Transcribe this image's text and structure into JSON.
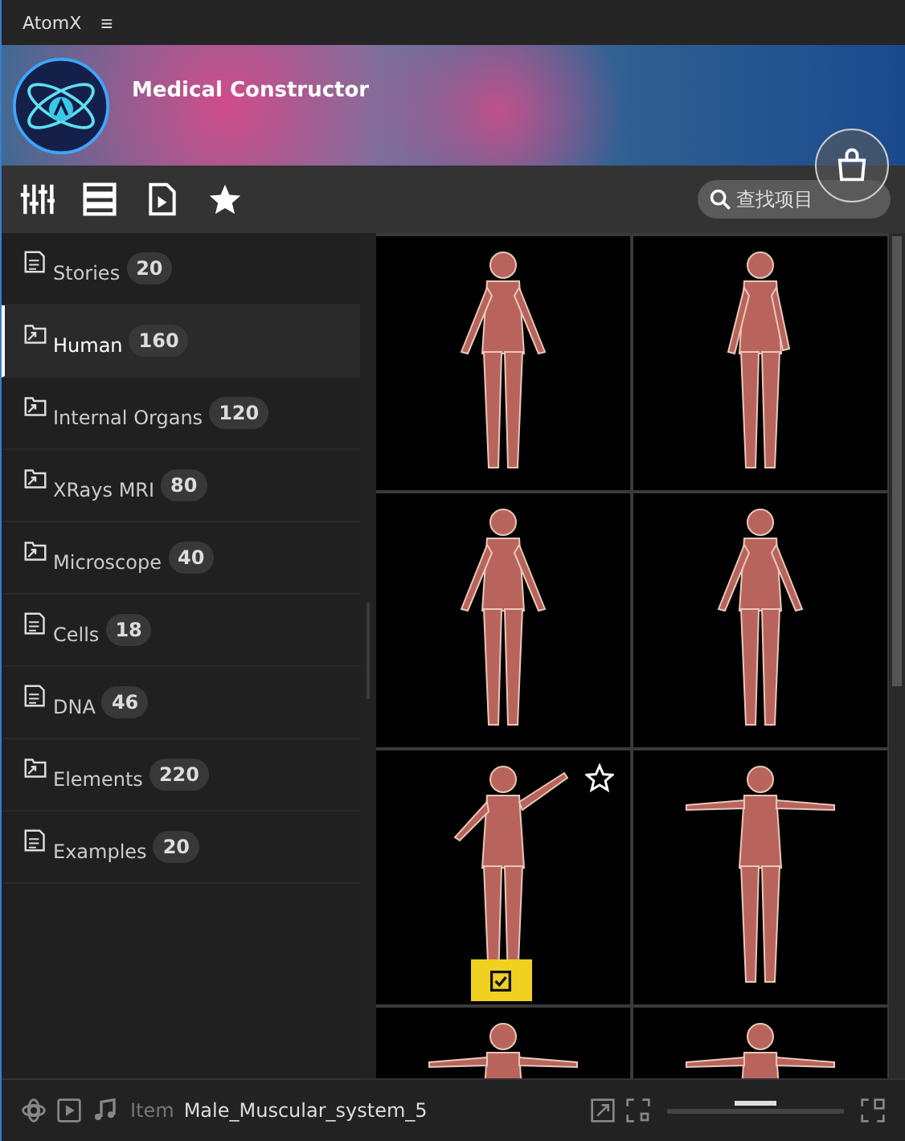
{
  "window": {
    "title": "AtomX",
    "menu_glyph": "≡"
  },
  "banner": {
    "title": "Medical Constructor"
  },
  "search": {
    "placeholder": "查找项目"
  },
  "categories": [
    {
      "kind": "ae",
      "label": "Stories",
      "count": "20",
      "selected": false
    },
    {
      "kind": "folder",
      "label": "Human",
      "count": "160",
      "selected": true
    },
    {
      "kind": "folder",
      "label": "Internal Organs",
      "count": "120",
      "selected": false
    },
    {
      "kind": "folder",
      "label": "XRays MRI",
      "count": "80",
      "selected": false
    },
    {
      "kind": "folder",
      "label": "Microscope",
      "count": "40",
      "selected": false
    },
    {
      "kind": "ae",
      "label": "Cells",
      "count": "18",
      "selected": false
    },
    {
      "kind": "ae",
      "label": "DNA",
      "count": "46",
      "selected": false
    },
    {
      "kind": "folder",
      "label": "Elements",
      "count": "220",
      "selected": false
    },
    {
      "kind": "ae",
      "label": "Examples",
      "count": "20",
      "selected": false
    }
  ],
  "tiles": [
    {
      "kind": "front",
      "hovered": false
    },
    {
      "kind": "turned",
      "hovered": false
    },
    {
      "kind": "front",
      "hovered": false
    },
    {
      "kind": "front",
      "hovered": false
    },
    {
      "kind": "side",
      "hovered": true
    },
    {
      "kind": "tpose",
      "hovered": false
    },
    {
      "kind": "tpose",
      "hovered": false
    },
    {
      "kind": "tpose",
      "hovered": false
    }
  ],
  "status_bar": {
    "label": "Item",
    "item_name": "Male_Muscular_system_5",
    "zoom": {
      "level": 0.5
    }
  }
}
